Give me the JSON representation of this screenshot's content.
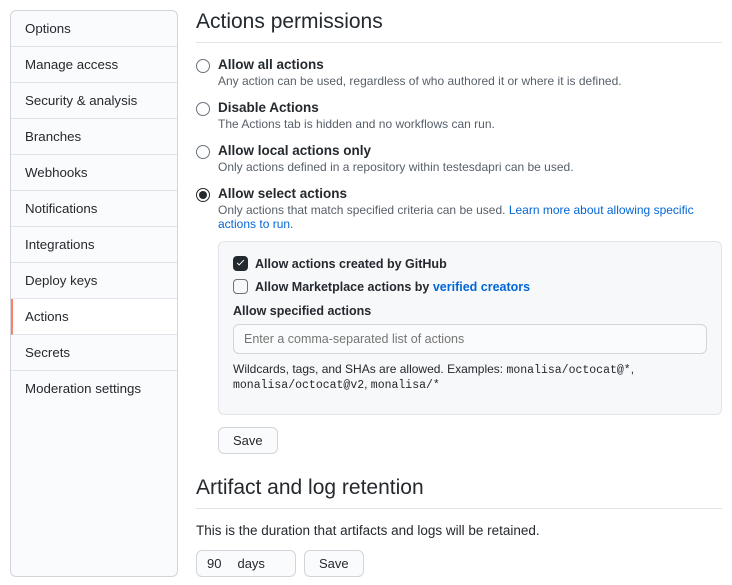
{
  "sidebar": {
    "items": [
      {
        "label": "Options"
      },
      {
        "label": "Manage access"
      },
      {
        "label": "Security & analysis"
      },
      {
        "label": "Branches"
      },
      {
        "label": "Webhooks"
      },
      {
        "label": "Notifications"
      },
      {
        "label": "Integrations"
      },
      {
        "label": "Deploy keys"
      },
      {
        "label": "Actions"
      },
      {
        "label": "Secrets"
      },
      {
        "label": "Moderation settings"
      }
    ]
  },
  "headings": {
    "actions_permissions": "Actions permissions",
    "artifact_retention": "Artifact and log retention"
  },
  "options": {
    "allow_all": {
      "title": "Allow all actions",
      "desc": "Any action can be used, regardless of who authored it or where it is defined."
    },
    "disable": {
      "title": "Disable Actions",
      "desc": "The Actions tab is hidden and no workflows can run."
    },
    "local": {
      "title": "Allow local actions only",
      "desc": "Only actions defined in a repository within testesdapri can be used."
    },
    "select": {
      "title": "Allow select actions",
      "desc": "Only actions that match specified criteria can be used. ",
      "link": "Learn more about allowing specific actions to run."
    }
  },
  "panel": {
    "cb_github": "Allow actions created by GitHub",
    "cb_marketplace_pre": "Allow Marketplace actions by ",
    "cb_marketplace_link": "verified creators",
    "subhead": "Allow specified actions",
    "placeholder": "Enter a comma-separated list of actions",
    "hint_pre": "Wildcards, tags, and SHAs are allowed. Examples: ",
    "ex1": "monalisa/octocat@*",
    "ex2": "monalisa/octocat@v2",
    "ex3": "monalisa/*"
  },
  "buttons": {
    "save": "Save"
  },
  "retention": {
    "desc": "This is the duration that artifacts and logs will be retained.",
    "value": "90",
    "unit": "days"
  }
}
